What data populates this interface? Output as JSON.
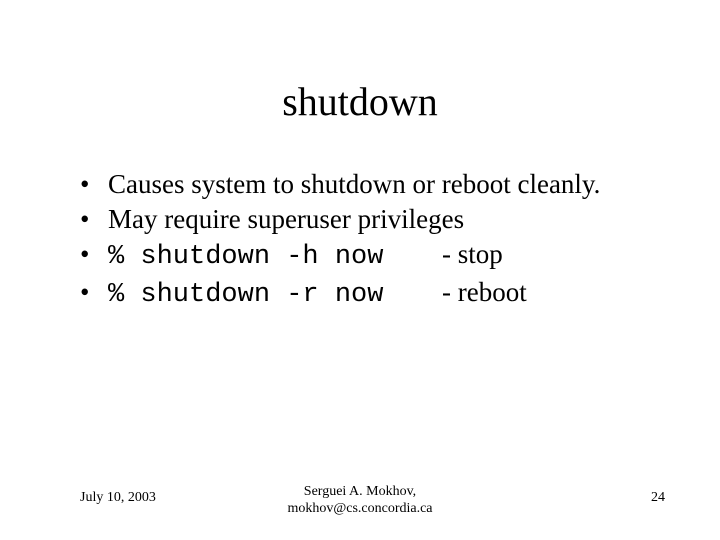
{
  "title": "shutdown",
  "bullets": [
    "Causes system to shutdown or reboot cleanly.",
    "May require superuser privileges"
  ],
  "cmd_bullets": [
    {
      "cmd": "% shutdown -h now",
      "desc": "- stop"
    },
    {
      "cmd": "% shutdown -r now",
      "desc": "- reboot"
    }
  ],
  "footer": {
    "date": "July 10, 2003",
    "author_line1": "Serguei A. Mokhov,",
    "author_line2": "mokhov@cs.concordia.ca",
    "page": "24"
  }
}
